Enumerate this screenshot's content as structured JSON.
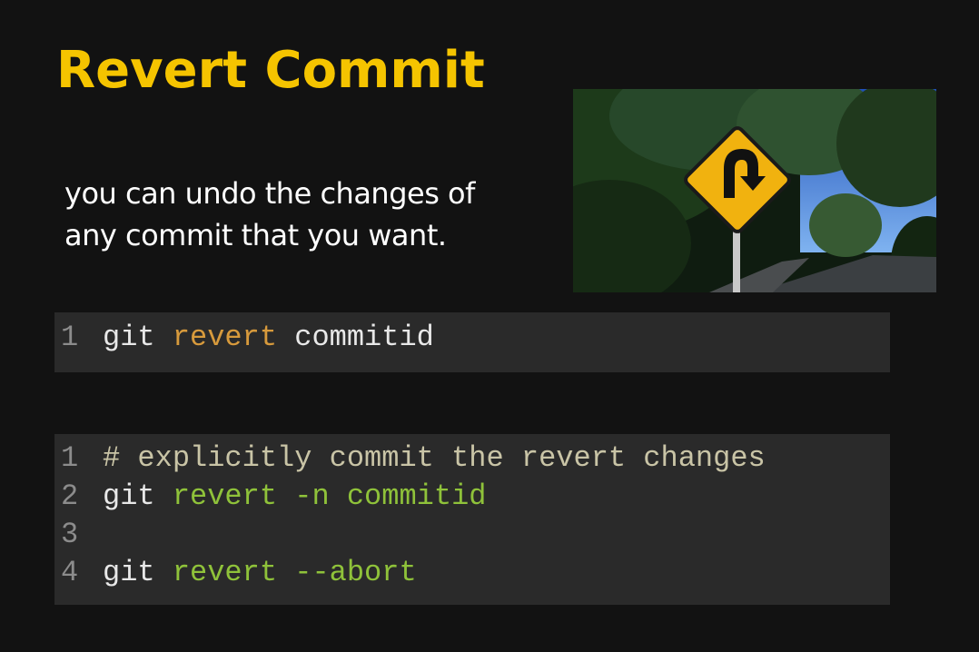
{
  "slide": {
    "title": "Revert Commit",
    "subtitle_lines": [
      "you can undo the changes of",
      "any commit that you want."
    ],
    "image": {
      "description_icon": "u-turn-road-sign-photo"
    }
  },
  "code_block_1": {
    "lines": [
      {
        "num": "1",
        "parts": [
          "git ",
          "revert",
          " commitid"
        ]
      }
    ]
  },
  "code_block_2": {
    "lines": [
      {
        "num": "1",
        "parts": [
          "# explicitly commit the revert changes"
        ]
      },
      {
        "num": "2",
        "parts": [
          "git ",
          "revert -n commitid"
        ]
      },
      {
        "num": "3",
        "parts": [
          ""
        ]
      },
      {
        "num": "4",
        "parts": [
          "git ",
          "revert --abort"
        ]
      }
    ]
  },
  "colors": {
    "title": "#f5c400",
    "keyword_orange": "#d79a3c",
    "keyword_green": "#8fc23a",
    "comment": "#c9c4a6",
    "code_bg": "#2a2a2a",
    "page_bg": "#121212"
  }
}
